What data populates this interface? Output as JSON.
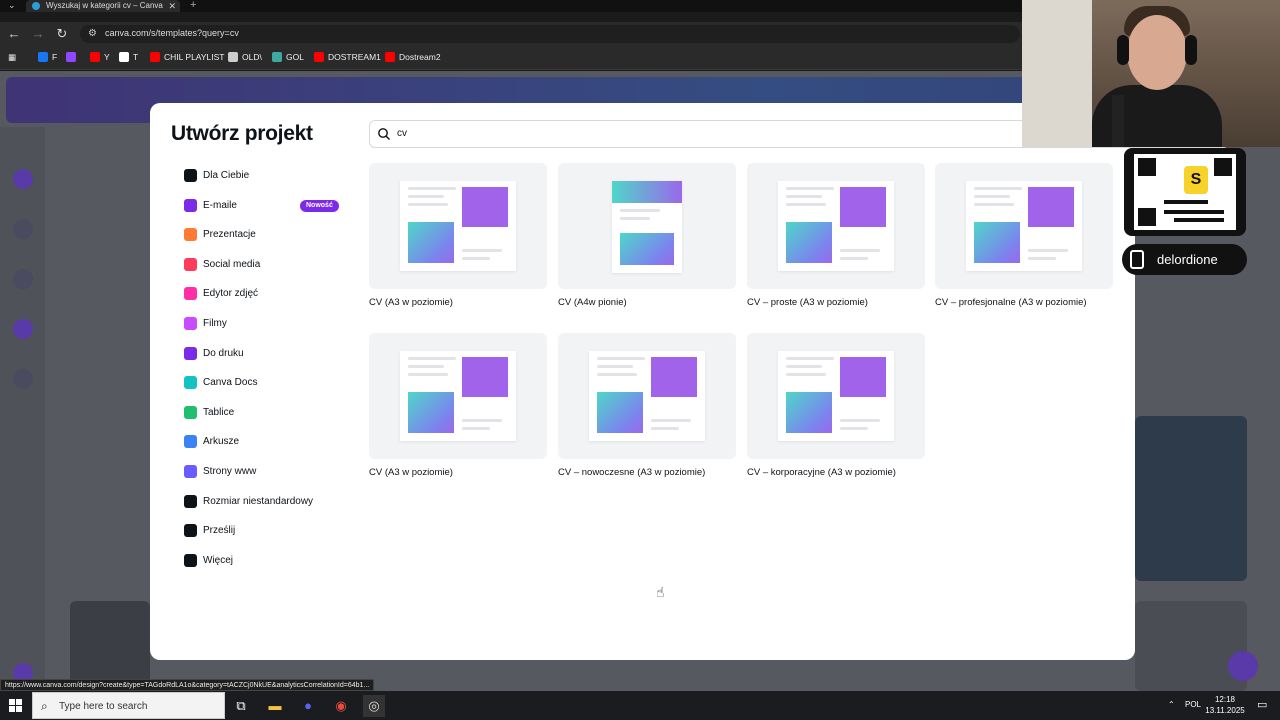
{
  "browser": {
    "tab_title": "Wyszukaj w kategorii cv – Canva",
    "url": "canva.com/s/templates?query=cv",
    "bookmarks": [
      {
        "label": "F",
        "icon": "facebook-icon",
        "color": "#1877f2"
      },
      {
        "label": "",
        "icon": "twitch-icon",
        "color": "#9146ff"
      },
      {
        "label": "Y",
        "icon": "youtube-icon",
        "color": "#ff0000"
      },
      {
        "label": "T",
        "icon": "x-icon",
        "color": "#ffffff"
      },
      {
        "label": "CHIL PLAYLIST",
        "icon": "youtube-icon",
        "color": "#ff0000"
      },
      {
        "label": "OLD\\",
        "icon": "folder-icon",
        "color": "#cccccc"
      },
      {
        "label": "GOL",
        "icon": "gol-icon",
        "color": "#3fa9a0"
      },
      {
        "label": "DOSTREAM1",
        "icon": "youtube-icon",
        "color": "#ff0000"
      },
      {
        "label": "Dostream2",
        "icon": "youtube-icon",
        "color": "#ff0000"
      }
    ]
  },
  "modal": {
    "title": "Utwórz projekt",
    "search_value": "cv",
    "menu": [
      {
        "label": "Dla Ciebie",
        "icon": "sparkle-icon",
        "color": "#0e1318"
      },
      {
        "label": "E-maile",
        "icon": "email-icon",
        "color": "#7d2ae8",
        "badge": "Nowość"
      },
      {
        "label": "Prezentacje",
        "icon": "presentation-icon",
        "color": "#ff7a35"
      },
      {
        "label": "Social media",
        "icon": "heart-icon",
        "color": "#ff3b5c"
      },
      {
        "label": "Edytor zdjęć",
        "icon": "camera-icon",
        "color": "#ff2ea6"
      },
      {
        "label": "Filmy",
        "icon": "video-icon",
        "color": "#c84bff"
      },
      {
        "label": "Do druku",
        "icon": "printer-icon",
        "color": "#7d2ae8"
      },
      {
        "label": "Canva Docs",
        "icon": "doc-icon",
        "color": "#13c2c2"
      },
      {
        "label": "Tablice",
        "icon": "whiteboard-icon",
        "color": "#1fbf6f"
      },
      {
        "label": "Arkusze",
        "icon": "sheet-icon",
        "color": "#3b82f6"
      },
      {
        "label": "Strony www",
        "icon": "website-icon",
        "color": "#6a5cff"
      },
      {
        "label": "Rozmiar niestandardowy",
        "icon": "custom-size-icon",
        "color": "#0e1318"
      },
      {
        "label": "Prześlij",
        "icon": "upload-cloud-icon",
        "color": "#0e1318"
      },
      {
        "label": "Więcej",
        "icon": "more-icon",
        "color": "#0e1318"
      }
    ],
    "templates": [
      {
        "label": "CV (A3 w poziomie)",
        "layout": "landscape"
      },
      {
        "label": "CV (A4w pionie)",
        "layout": "portrait"
      },
      {
        "label": "CV – proste (A3 w poziomie)",
        "layout": "landscape"
      },
      {
        "label": "CV – profesjonalne (A3 w poziomie)",
        "layout": "landscape"
      },
      {
        "label": "CV (A3 w poziomie)",
        "layout": "landscape"
      },
      {
        "label": "CV – nowoczesne (A3 w poziomie)",
        "layout": "landscape"
      },
      {
        "label": "CV – korporacyjne (A3 w poziomie)",
        "layout": "landscape"
      }
    ]
  },
  "overlay": {
    "qr_letter": "S",
    "handle": "delordione"
  },
  "status_url": "https://www.canva.com/design?create&type=TAGdoRdLA1o&category=tACZCj0NkUE&analyticsCorrelationId=64b1...",
  "taskbar": {
    "search_placeholder": "Type here to search",
    "language": "POL",
    "time": "12:18",
    "date": "13.11.2025"
  }
}
